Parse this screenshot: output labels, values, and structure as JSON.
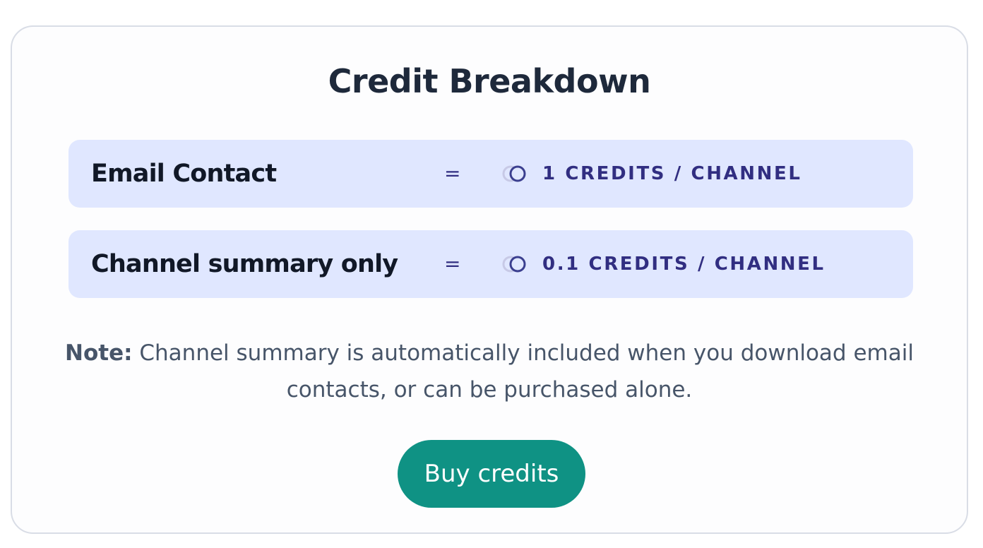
{
  "panel": {
    "title": "Credit Breakdown"
  },
  "rows": [
    {
      "label": "Email Contact",
      "separator": "=",
      "icon": "coins-icon",
      "value": "1 CREDITS / CHANNEL"
    },
    {
      "label": "Channel summary only",
      "separator": "=",
      "icon": "coins-icon",
      "value": "0.1 CREDITS / CHANNEL"
    }
  ],
  "note": {
    "prefix": "Note:",
    "text": "Channel summary is automatically included when you download email contacts, or can be purchased alone."
  },
  "actions": {
    "buy_label": "Buy credits"
  },
  "colors": {
    "accent": "#0f9284",
    "row_background": "#e0e7ff",
    "value_text": "#312e81",
    "title_text": "#1e293b"
  }
}
